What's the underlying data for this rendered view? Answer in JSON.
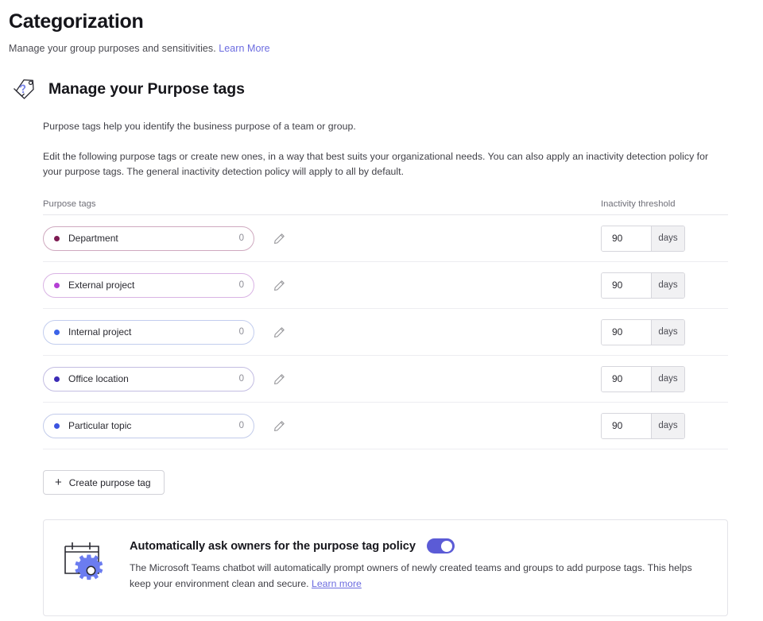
{
  "header": {
    "title": "Categorization",
    "subtitle_text": "Manage your group purposes and sensitivities.",
    "subtitle_link": "Learn More"
  },
  "section": {
    "icon": "purpose-tag-icon",
    "title": "Manage your Purpose tags",
    "paragraph1": "Purpose tags help you identify the business purpose of a team or group.",
    "paragraph2": "Edit the following purpose tags or create new ones, in a way that best suits your organizational needs. You can also apply an inactivity detection policy for your purpose tags. The general inactivity detection policy will apply to all by default."
  },
  "table": {
    "columns": {
      "tags": "Purpose tags",
      "threshold": "Inactivity threshold"
    },
    "rows": [
      {
        "name": "Department",
        "count": "0",
        "dot_color": "#7d1b52",
        "pill_border": "#cfa9bf",
        "threshold": "90",
        "unit": "days",
        "edit_icon": "pencil-icon"
      },
      {
        "name": "External project",
        "count": "0",
        "dot_color": "#b43fd4",
        "pill_border": "#d9b3e4",
        "threshold": "90",
        "unit": "days",
        "edit_icon": "pencil-icon"
      },
      {
        "name": "Internal project",
        "count": "0",
        "dot_color": "#3b63e8",
        "pill_border": "#c2cdee",
        "threshold": "90",
        "unit": "days",
        "edit_icon": "pencil-icon"
      },
      {
        "name": "Office location",
        "count": "0",
        "dot_color": "#3b2bb5",
        "pill_border": "#c3bde2",
        "threshold": "90",
        "unit": "days",
        "edit_icon": "pencil-icon"
      },
      {
        "name": "Particular topic",
        "count": "0",
        "dot_color": "#3b54e0",
        "pill_border": "#c2cbea",
        "threshold": "90",
        "unit": "days",
        "edit_icon": "pencil-icon"
      }
    ]
  },
  "create_button": {
    "label": "Create purpose tag",
    "icon": "plus-icon",
    "plus": "+"
  },
  "policy_card": {
    "icon": "calendar-gear-icon",
    "title": "Automatically ask owners for the purpose tag policy",
    "toggle_state": "on",
    "description": "The Microsoft Teams chatbot will automatically prompt owners of newly created teams and groups to add purpose tags. This helps keep your environment clean and secure.",
    "link": "Learn more"
  },
  "colors": {
    "accent": "#5b5bd6",
    "link": "#6c6ce0",
    "text": "#1b1b1f",
    "muted": "#6f6f78",
    "divider": "#e6e6ea"
  }
}
